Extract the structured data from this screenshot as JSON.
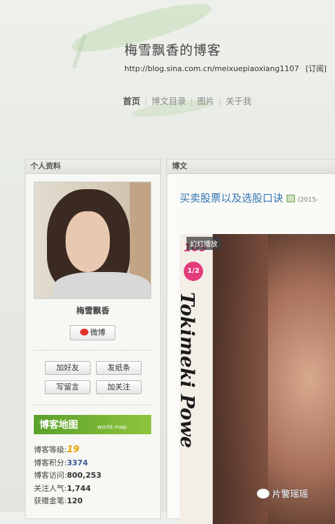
{
  "header": {
    "title": "梅雪飘香的博客",
    "url": "http://blog.sina.com.cn/meixuepiaoxiang1107",
    "subscribe": "[订阅]"
  },
  "nav": {
    "items": [
      "首页",
      "博文目录",
      "图片",
      "关于我"
    ]
  },
  "profile": {
    "panel_title": "个人资料",
    "name": "梅雪飘香",
    "weibo_button": "微博",
    "buttons": {
      "add_friend": "加好友",
      "send_note": "发纸条",
      "leave_message": "写留言",
      "follow": "加关注"
    },
    "map_banner": {
      "title": "博客地图",
      "subtitle": "world map"
    },
    "stats": [
      {
        "label": "博客等级:",
        "value": "19"
      },
      {
        "label": "博客积分:",
        "value": "3374"
      },
      {
        "label": "博客访问:",
        "value": "800,253"
      },
      {
        "label": "关注人气:",
        "value": "1,744"
      },
      {
        "label": "获赠金笔:",
        "value": "120"
      }
    ]
  },
  "posts": {
    "panel_title": "博文",
    "post_title": "买卖股票以及选股口诀",
    "post_date": "(2015-",
    "slideshow": "幻灯播放",
    "cover": {
      "issue": "109",
      "badge": "1/2",
      "vertical_text": "Tokimeki Powe"
    }
  },
  "watermark": "片警瑶瑶"
}
